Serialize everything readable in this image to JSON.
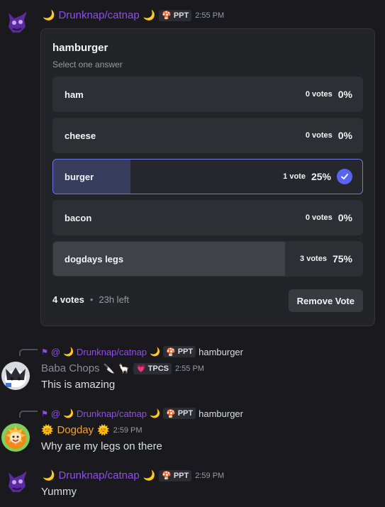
{
  "message1": {
    "username": "Drunknap/catnap",
    "moon_left": "🌙",
    "moon_right": "🌙",
    "tag": "PPT",
    "time": "2:55 PM"
  },
  "poll": {
    "question": "hamburger",
    "subtitle": "Select one answer",
    "options": [
      {
        "label": "ham",
        "votes": "0 votes",
        "percent": "0%",
        "fill": 0,
        "selected": false
      },
      {
        "label": "cheese",
        "votes": "0 votes",
        "percent": "0%",
        "fill": 0,
        "selected": false
      },
      {
        "label": "burger",
        "votes": "1 vote",
        "percent": "25%",
        "fill": 0.25,
        "selected": true
      },
      {
        "label": "bacon",
        "votes": "0 votes",
        "percent": "0%",
        "fill": 0,
        "selected": false
      },
      {
        "label": "dogdays legs",
        "votes": "3 votes",
        "percent": "75%",
        "fill": 0.75,
        "selected": false
      }
    ],
    "total_votes": "4 votes",
    "dot": "•",
    "time_left": "23h left",
    "remove_vote": "Remove Vote"
  },
  "message2": {
    "reply": {
      "at": "@",
      "username": "Drunknap/catnap",
      "tag": "PPT",
      "text": "hamburger"
    },
    "username": "Baba Chops",
    "tag": "TPCS",
    "time": "2:55 PM",
    "text": "This is amazing"
  },
  "message3": {
    "reply": {
      "at": "@",
      "username": "Drunknap/catnap",
      "tag": "PPT",
      "text": "hamburger"
    },
    "username": "Dogday",
    "time": "2:59 PM",
    "text": "Why are my legs on there"
  },
  "message4": {
    "username": "Drunknap/catnap",
    "tag": "PPT",
    "time": "2:59 PM",
    "text": "Yummy"
  },
  "colors": {
    "accent": "#5865f2",
    "username_purple": "#8f4ee8",
    "username_orange": "#f0a131"
  }
}
